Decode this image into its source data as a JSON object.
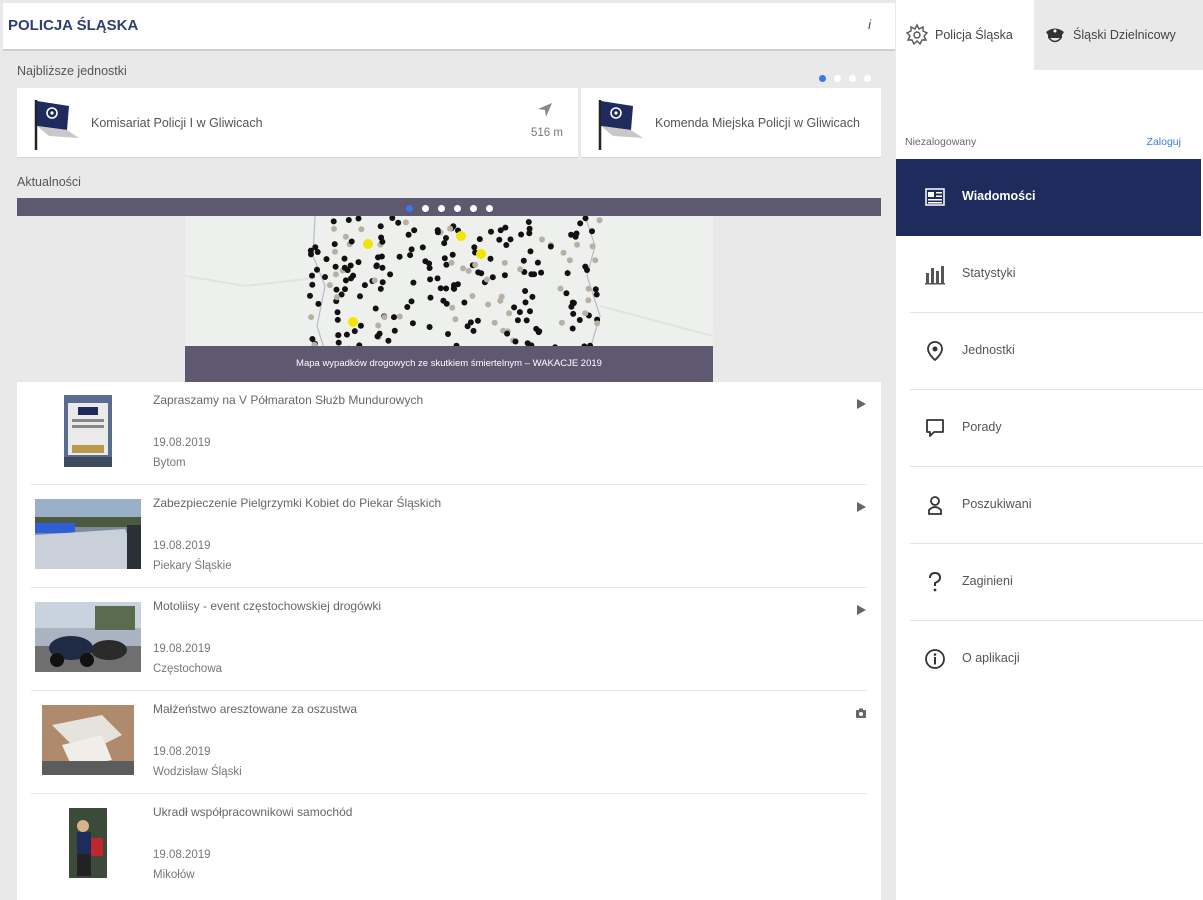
{
  "app": {
    "title": "POLICJA ŚLĄSKA",
    "info_icon_text": "i"
  },
  "nearest": {
    "label": "Najbliższe jednostki",
    "units": [
      {
        "name": "Komisariat Policji I w Gliwicach",
        "distance": "516 m"
      },
      {
        "name": "Komenda Miejska Policji w Gliwicach"
      }
    ]
  },
  "news": {
    "label": "Aktualności",
    "featured_caption": "Mapa wypadków drogowych ze skutkiem śmiertelnym – WAKACJE 2019",
    "items": [
      {
        "title": "Zapraszamy na V Półmaraton Służb Mundurowych",
        "date": "19.08.2019",
        "place": "Bytom",
        "type_icon": "play-icon"
      },
      {
        "title": "Zabezpieczenie Pielgrzymki Kobiet do Piekar Śląskich",
        "date": "19.08.2019",
        "place": "Piekary Śląskie",
        "type_icon": "play-icon"
      },
      {
        "title": "Motoliisy - event częstochowskiej drogówki",
        "date": "19.08.2019",
        "place": "Częstochowa",
        "type_icon": "play-icon"
      },
      {
        "title": "Małżeństwo aresztowane za oszustwa",
        "date": "19.08.2019",
        "place": "Wodzisław Śląski",
        "type_icon": "camera-icon"
      },
      {
        "title": "Ukradł współpracownikowi samochód",
        "date": "19.08.2019",
        "place": "Mikołów"
      }
    ]
  },
  "sidebar": {
    "tabs": [
      {
        "label": "Policja Śląska",
        "icon": "police-star-icon"
      },
      {
        "label": "Śląski Dzielnicowy",
        "icon": "police-cap-icon"
      }
    ],
    "status": "Niezalogowany",
    "login": "Zaloguj",
    "menu": [
      {
        "label": "Wiadomości",
        "icon": "news-icon",
        "active": true
      },
      {
        "label": "Statystyki",
        "icon": "stats-icon"
      },
      {
        "label": "Jednostki",
        "icon": "location-pin-icon"
      },
      {
        "label": "Porady",
        "icon": "chat-bubble-icon"
      },
      {
        "label": "Poszukiwani",
        "icon": "wanted-person-icon"
      },
      {
        "label": "Zaginieni",
        "icon": "question-icon"
      },
      {
        "label": "O aplikacji",
        "icon": "info-icon"
      }
    ]
  },
  "colors": {
    "brand_navy": "#1e2b5c",
    "title_blue": "#2b3f74",
    "carousel_bar": "#5e5871",
    "active_dot": "#3b78e7",
    "map_marker_yellow": "#f2e600"
  }
}
